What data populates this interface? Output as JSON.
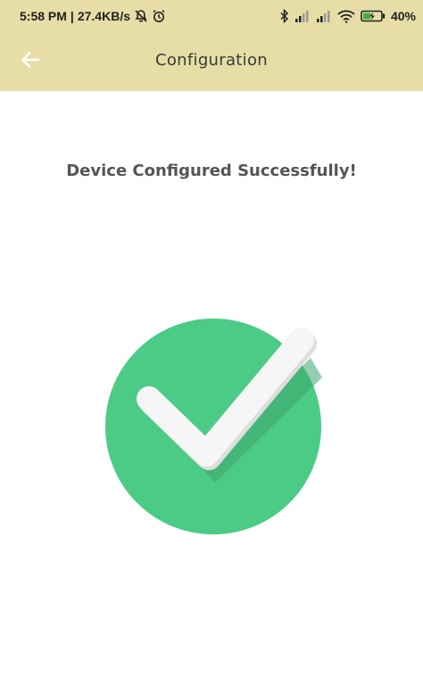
{
  "status_bar": {
    "time": "5:58 PM",
    "separator": "|",
    "network_speed": "27.4KB/s",
    "battery": "40%",
    "icons": [
      "notifications-off-icon",
      "alarm-icon",
      "bluetooth-icon",
      "signal-icon",
      "signal-icon",
      "wifi-icon",
      "battery-charging-icon"
    ]
  },
  "app_bar": {
    "title": "Configuration",
    "back_icon": "arrow-back-icon"
  },
  "main": {
    "message": "Device Configured Successfully!",
    "graphic_icon": "checkmark-circle-icon"
  },
  "colors": {
    "app_bar": "#e6dea6",
    "success_green": "#4bcb86",
    "check_white": "#f6f6f6"
  }
}
